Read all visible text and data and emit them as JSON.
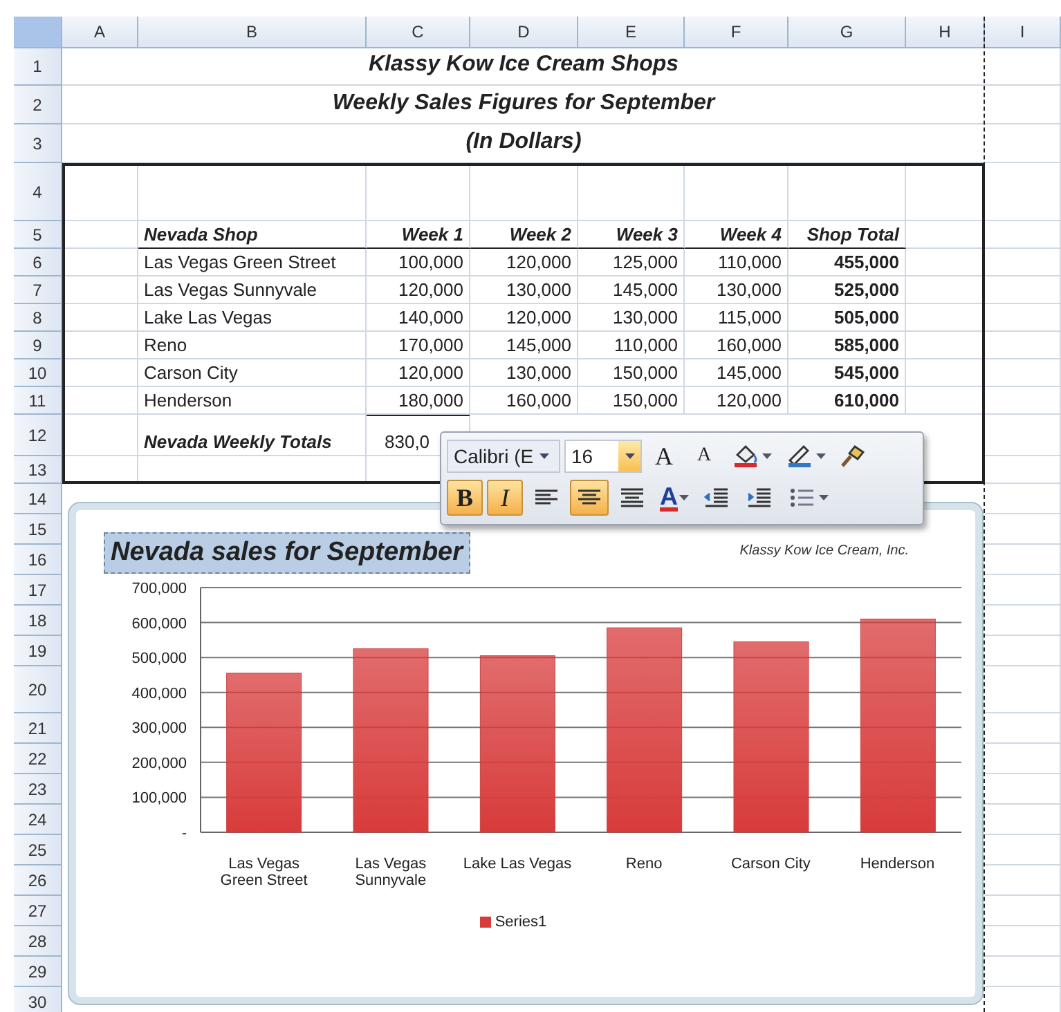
{
  "column_headers": [
    "A",
    "B",
    "C",
    "D",
    "E",
    "F",
    "G",
    "H",
    "I"
  ],
  "row_headers": [
    "1",
    "2",
    "3",
    "4",
    "5",
    "6",
    "7",
    "8",
    "9",
    "10",
    "11",
    "12",
    "13",
    "14",
    "15",
    "16",
    "17",
    "18",
    "19",
    "20",
    "21",
    "22",
    "23",
    "24",
    "25",
    "26",
    "27",
    "28",
    "29",
    "30"
  ],
  "titles": [
    "Klassy Kow Ice Cream Shops",
    "Weekly Sales Figures for September",
    "(In Dollars)"
  ],
  "table": {
    "columns": [
      "Nevada Shop",
      "Week 1",
      "Week 2",
      "Week 3",
      "Week 4",
      "Shop Total"
    ],
    "rows": [
      {
        "cells": [
          "Las Vegas Green Street",
          "100,000",
          "120,000",
          "125,000",
          "110,000",
          "455,000"
        ]
      },
      {
        "cells": [
          "Las Vegas Sunnyvale",
          "120,000",
          "130,000",
          "145,000",
          "130,000",
          "525,000"
        ]
      },
      {
        "cells": [
          "Lake Las Vegas",
          "140,000",
          "120,000",
          "130,000",
          "115,000",
          "505,000"
        ]
      },
      {
        "cells": [
          "Reno",
          "170,000",
          "145,000",
          "110,000",
          "160,000",
          "585,000"
        ]
      },
      {
        "cells": [
          "Carson City",
          "120,000",
          "130,000",
          "150,000",
          "145,000",
          "545,000"
        ]
      },
      {
        "cells": [
          "Henderson",
          "180,000",
          "160,000",
          "150,000",
          "120,000",
          "610,000"
        ]
      }
    ],
    "totals_row": {
      "label": "Nevada Weekly Totals",
      "value": "830,0"
    }
  },
  "mini_toolbar": {
    "font": "Calibri (E",
    "size": "16",
    "top_buttons": [
      {
        "kind": "grow",
        "glyph": "A"
      },
      {
        "kind": "shrink",
        "glyph": "A"
      },
      {
        "kind": "fill"
      },
      {
        "kind": "line"
      },
      {
        "kind": "painter"
      }
    ],
    "format_buttons": [
      {
        "kind": "bold",
        "glyph": "B",
        "selected": true
      },
      {
        "kind": "italic",
        "glyph": "I",
        "selected": true
      },
      {
        "kind": "align-left",
        "selected": false
      },
      {
        "kind": "align-center",
        "selected": true
      },
      {
        "kind": "wrap",
        "selected": false
      },
      {
        "kind": "font-color",
        "glyph": "A",
        "selected": false
      },
      {
        "kind": "outdent",
        "selected": false
      },
      {
        "kind": "indent",
        "selected": false
      },
      {
        "kind": "bullets",
        "selected": false
      }
    ]
  },
  "chart": {
    "title": "Nevada sales for September",
    "subtitle": "Klassy Kow Ice Cream, Inc.",
    "chart_data": {
      "type": "bar",
      "grid": true,
      "categories": [
        "Las Vegas Green Street",
        "Las Vegas Sunnyvale",
        "Lake Las Vegas",
        "Reno",
        "Carson City",
        "Henderson"
      ],
      "series": [
        {
          "name": "Series1",
          "color": "#d83b3b",
          "values": [
            455000,
            525000,
            505000,
            585000,
            545000,
            610000
          ]
        }
      ],
      "ylim": [
        0,
        700000
      ],
      "yticks": [
        {
          "value": 0,
          "label": "-"
        },
        {
          "value": 100000,
          "label": "100,000"
        },
        {
          "value": 200000,
          "label": "200,000"
        },
        {
          "value": 300000,
          "label": "300,000"
        },
        {
          "value": 400000,
          "label": "400,000"
        },
        {
          "value": 500000,
          "label": "500,000"
        },
        {
          "value": 600000,
          "label": "600,000"
        },
        {
          "value": 700000,
          "label": "700,000"
        }
      ]
    }
  }
}
